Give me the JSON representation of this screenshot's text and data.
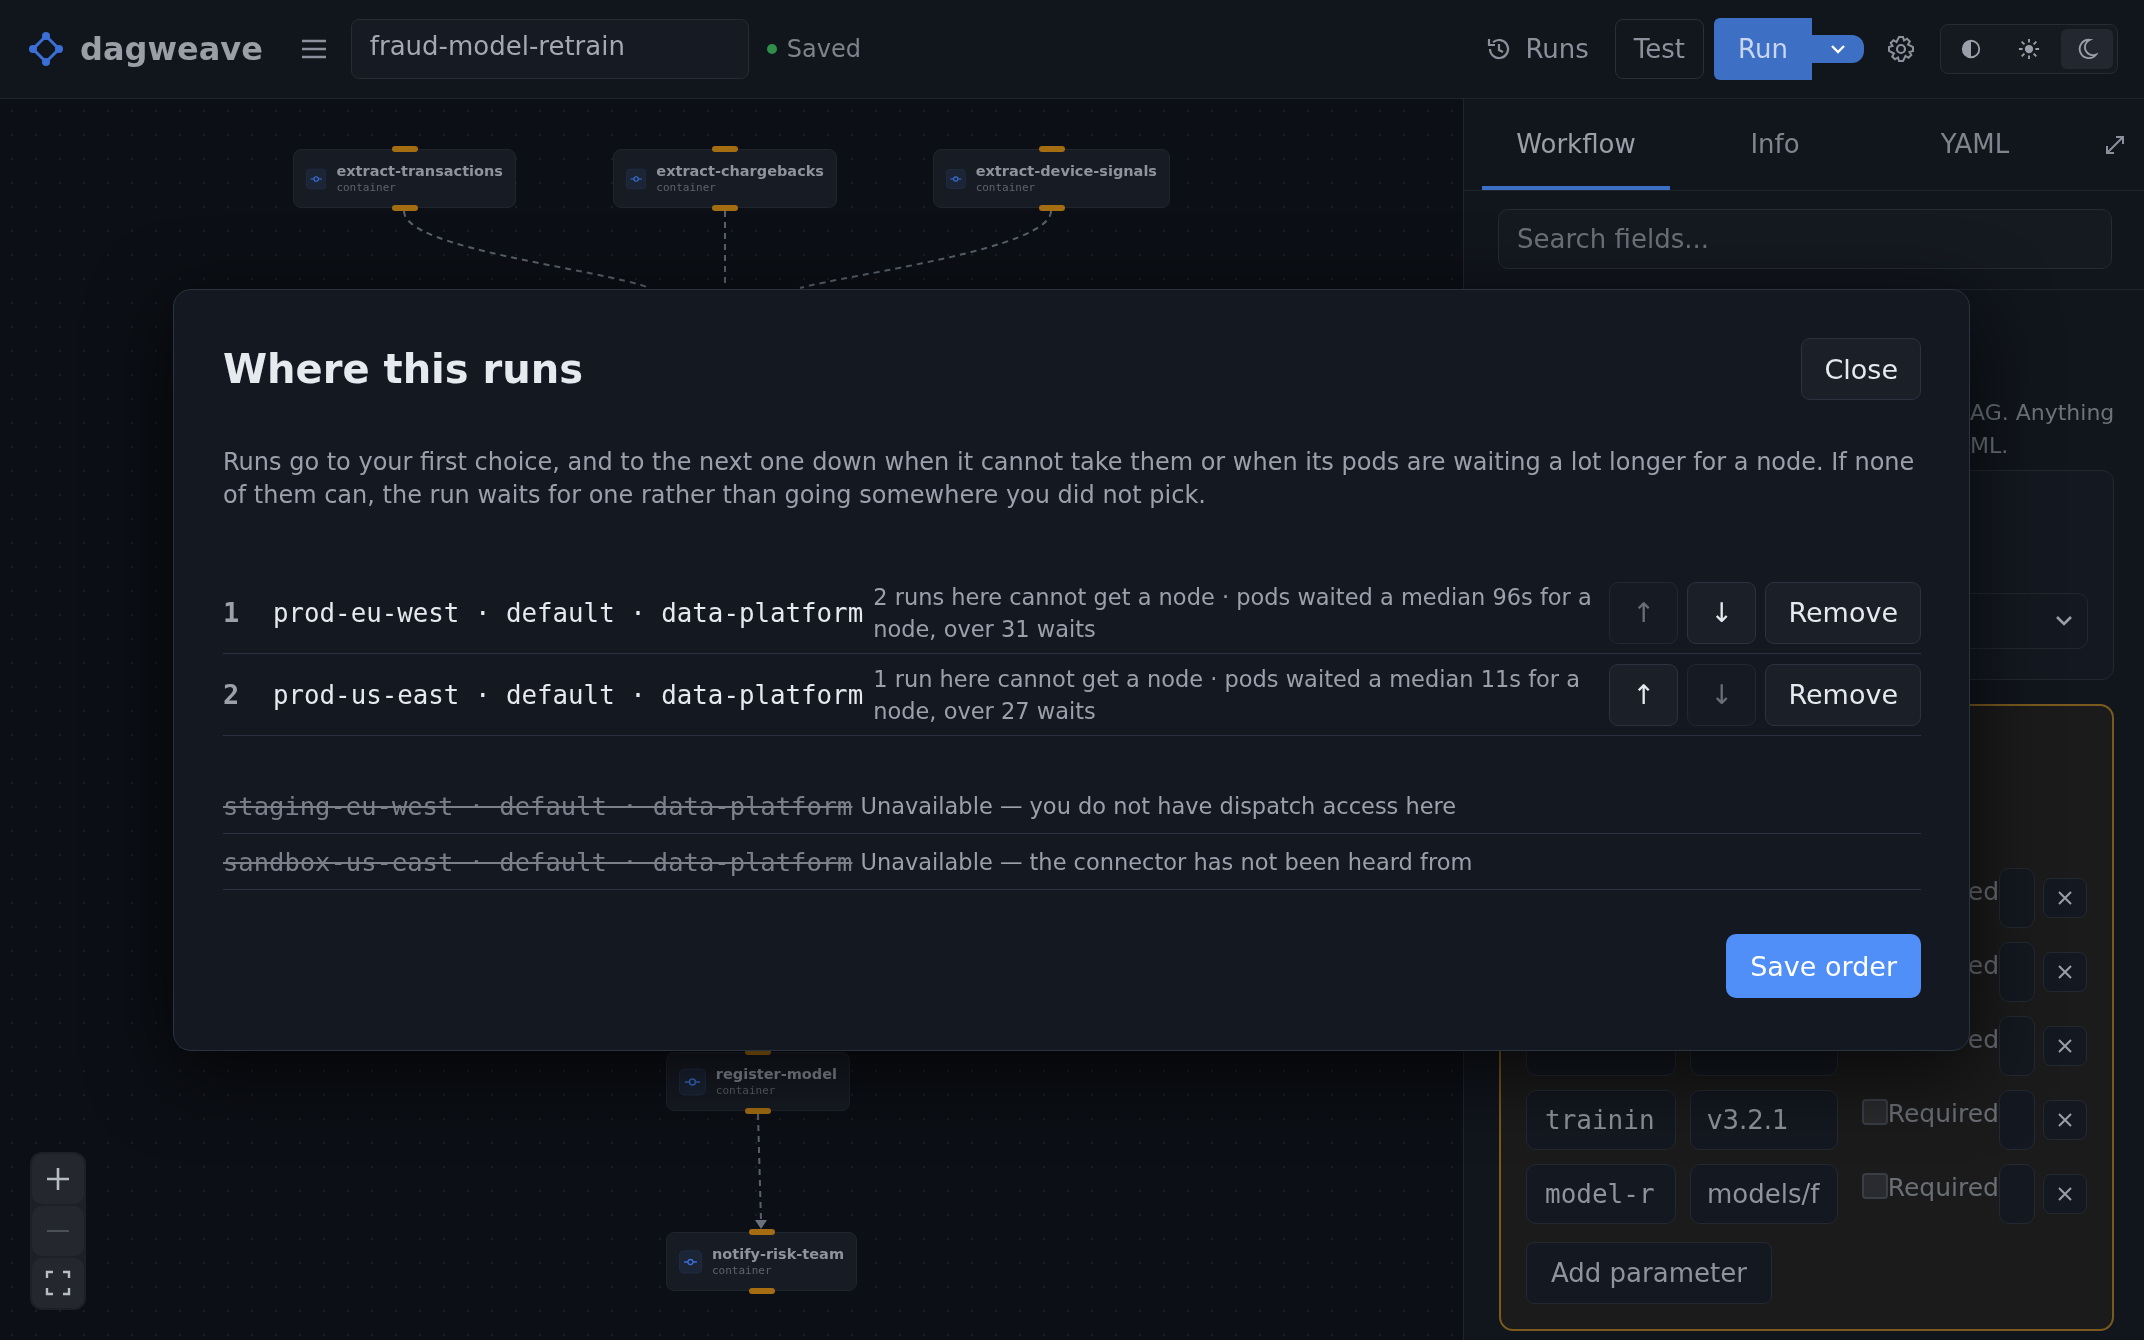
{
  "app": {
    "name": "dagweave"
  },
  "workflow_name": "fraud-model-retrain",
  "save_status": "Saved",
  "toolbar": {
    "runs_label": "Runs",
    "test_label": "Test",
    "run_label": "Run"
  },
  "theme_modes": [
    {
      "kind": "auto",
      "selected": false
    },
    {
      "kind": "light",
      "selected": false
    },
    {
      "kind": "dark",
      "selected": true
    }
  ],
  "canvas": {
    "nodes": [
      {
        "name": "extract-transactions",
        "type": "container"
      },
      {
        "name": "extract-chargebacks",
        "type": "container"
      },
      {
        "name": "extract-device-signals",
        "type": "container"
      },
      {
        "name": "register-model",
        "type": "container"
      },
      {
        "name": "notify-risk-team",
        "type": "container"
      }
    ]
  },
  "panel": {
    "tabs": [
      {
        "label": "Workflow",
        "selected": true
      },
      {
        "label": "Info",
        "selected": false
      },
      {
        "label": "YAML",
        "selected": false
      }
    ],
    "search": {
      "placeholder": "Search fields..."
    },
    "description_fragments": [
      "AG. Anything",
      "ML."
    ],
    "parameters": [
      {
        "kind": "covered",
        "required_label": "ed"
      },
      {
        "kind": "covered",
        "required_label": "ed"
      },
      {
        "kind": "partial",
        "required_label": "ed"
      },
      {
        "kind": "full",
        "key": "trainin",
        "value": "v3.2.1",
        "required": false,
        "required_label": "Required"
      },
      {
        "kind": "full",
        "key": "model-r",
        "value": "models/f",
        "required": false,
        "required_label": "Required"
      }
    ],
    "add_parameter": "Add parameter"
  },
  "modal": {
    "title": "Where this runs",
    "close": "Close",
    "description": "Runs go to your first choice, and to the next one down when it cannot take them or when its pods are waiting a lot longer for a node. If none of them can, the run waits for one rather than going somewhere you did not pick.",
    "targets": [
      {
        "rank": "1",
        "name": "prod-eu-west · default · data-platform",
        "note": "2 runs here cannot get a node · pods waited a median 96s for a node, over 31 waits",
        "up": "↑",
        "up_disabled": true,
        "down": "↓",
        "down_disabled": false,
        "remove": "Remove"
      },
      {
        "rank": "2",
        "name": "prod-us-east · default · data-platform",
        "note": "1 run here cannot get a node · pods waited a median 11s for a node, over 27 waits",
        "up": "↑",
        "up_disabled": false,
        "down": "↓",
        "down_disabled": true,
        "remove": "Remove"
      }
    ],
    "unavailable": [
      {
        "name": "staging-eu-west · default · data-platform",
        "note": "Unavailable — you do not have dispatch access here"
      },
      {
        "name": "sandbox-us-east · default · data-platform",
        "note": "Unavailable — the connector has not been heard from"
      }
    ],
    "save": "Save order"
  }
}
